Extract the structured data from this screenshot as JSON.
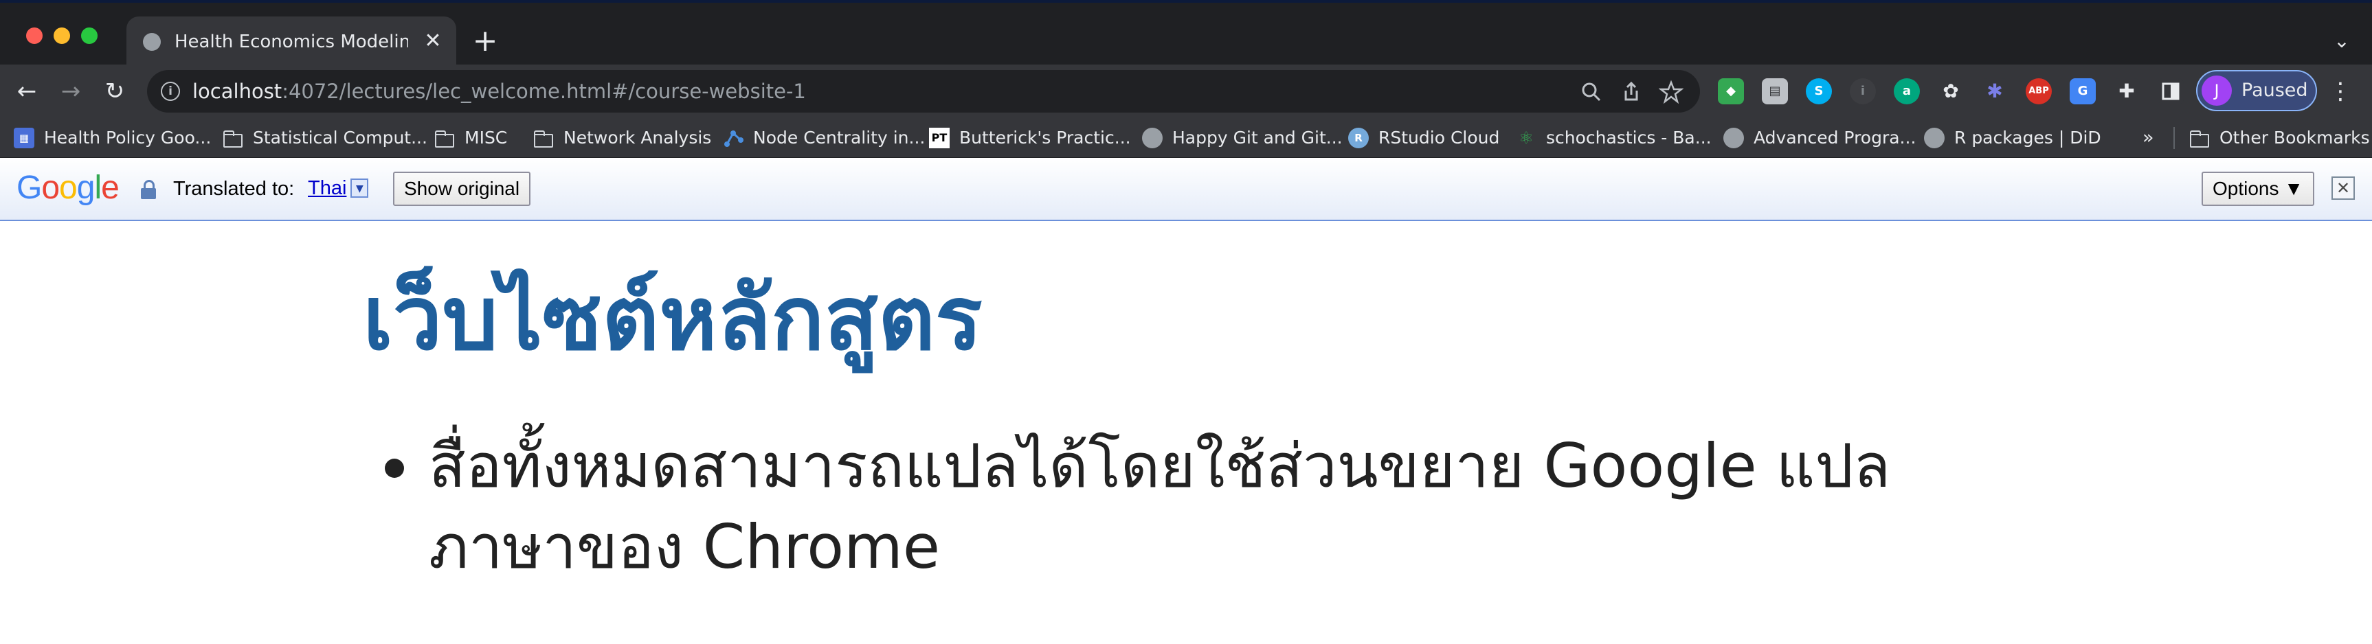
{
  "window": {
    "traffic_lights": [
      "close",
      "minimize",
      "zoom"
    ]
  },
  "tab": {
    "title": "Health Economics Modeling W",
    "close_label": "✕",
    "new_tab_label": "+",
    "tab_search_label": "⌄"
  },
  "toolbar": {
    "back_label": "←",
    "forward_label": "→",
    "reload_label": "↻",
    "url_host": "localhost",
    "url_rest": ":4072/lectures/lec_welcome.html#/course-website-1",
    "profile_initial": "J",
    "profile_label": "Paused",
    "menu_label": "⋮",
    "extensions": [
      {
        "icon": "tag-extension-icon",
        "color": "#34a853"
      },
      {
        "icon": "document-extension-icon",
        "color": "#bdc1c6"
      },
      {
        "icon": "skype-extension-icon",
        "color": "#00aff0"
      },
      {
        "icon": "info-extension-icon",
        "color": "#5f6368"
      },
      {
        "icon": "a-extension-icon",
        "color": "#00a67e"
      },
      {
        "icon": "flower-extension-icon",
        "color": "#e8eaed"
      },
      {
        "icon": "gear-extension-icon",
        "color": "#5b5fc7"
      },
      {
        "icon": "adblock-plus-icon",
        "color": "#d93025",
        "text": "ABP"
      },
      {
        "icon": "google-translate-extension-icon",
        "color": "#4285f4"
      },
      {
        "icon": "puzzle-icon",
        "color": "#e8eaed"
      },
      {
        "icon": "side-panel-icon",
        "color": "#e8eaed"
      }
    ]
  },
  "bookmarks": {
    "items": [
      {
        "label": "Health Policy Goo...",
        "icon": "table-icon"
      },
      {
        "label": "Statistical Comput...",
        "icon": "folder-icon"
      },
      {
        "label": "MISC",
        "icon": "folder-icon"
      },
      {
        "label": "Network Analysis",
        "icon": "folder-icon"
      },
      {
        "label": "Node Centrality in...",
        "icon": "network-icon"
      },
      {
        "label": "Butterick's Practic...",
        "icon": "pt-icon",
        "text": "PT"
      },
      {
        "label": "Happy Git and Git...",
        "icon": "globe-icon"
      },
      {
        "label": "RStudio Cloud",
        "icon": "rstudio-icon",
        "text": "R"
      },
      {
        "label": "schochastics - Ba...",
        "icon": "atom-icon"
      },
      {
        "label": "Advanced Progra...",
        "icon": "globe-icon"
      },
      {
        "label": "R packages | DiD",
        "icon": "globe-icon"
      }
    ],
    "overflow_label": "»",
    "other_label": "Other Bookmarks"
  },
  "translate_bar": {
    "translated_label": "Translated to:",
    "language": "Thai",
    "language_arrow": "▼",
    "show_original_label": "Show original",
    "options_label": "Options ▼",
    "close_label": "✕",
    "logo_letters": [
      {
        "char": "G",
        "color": "#4285f4"
      },
      {
        "char": "o",
        "color": "#ea4335"
      },
      {
        "char": "o",
        "color": "#fbbc05"
      },
      {
        "char": "g",
        "color": "#4285f4"
      },
      {
        "char": "l",
        "color": "#34a853"
      },
      {
        "char": "e",
        "color": "#ea4335"
      }
    ]
  },
  "page": {
    "title": "เว็บไซต์หลักสูตร",
    "bullets": [
      "สื่อทั้งหมดสามารถแปลได้โดยใช้ส่วนขยาย Google แปลภาษาของ Chrome"
    ],
    "title_color": "#1f5f9c"
  }
}
